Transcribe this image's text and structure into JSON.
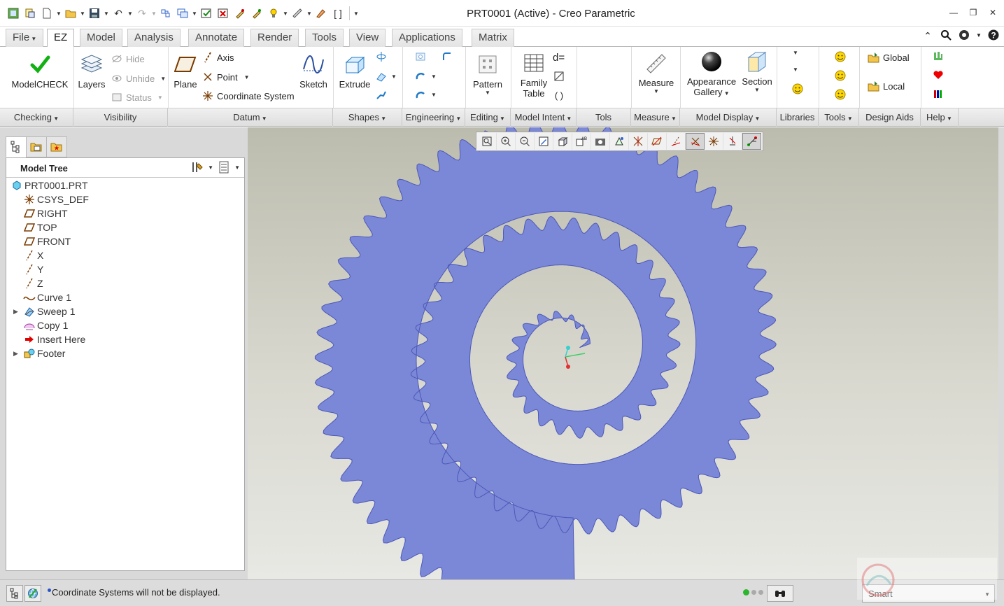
{
  "window": {
    "title": "PRT0001 (Active) - Creo Parametric"
  },
  "quick_access": [
    "new-session-icon",
    "open-file-icon",
    "new-file-icon",
    "open-folder-icon",
    "save-icon",
    "undo-icon",
    "redo-icon",
    "regenerate-icon",
    "windows-icon",
    "check-icon",
    "close-window-icon",
    "paint-icon",
    "paint2-icon",
    "bulb-icon",
    "ruler-icon",
    "rename-icon",
    "brackets-icon",
    "customize-icon"
  ],
  "tabs": [
    {
      "label": "File"
    },
    {
      "label": "EZ"
    },
    {
      "label": "Model"
    },
    {
      "label": "Analysis"
    },
    {
      "label": "Annotate"
    },
    {
      "label": "Render"
    },
    {
      "label": "Tools"
    },
    {
      "label": "View"
    },
    {
      "label": "Applications"
    },
    {
      "label": "Matrix"
    }
  ],
  "ribbon": {
    "modelcheck": "ModelCHECK",
    "layers": "Layers",
    "hide": "Hide",
    "unhide": "Unhide",
    "status": "Status",
    "plane": "Plane",
    "axis": "Axis",
    "point": "Point",
    "coordinate_system": "Coordinate System",
    "sketch": "Sketch",
    "extrude": "Extrude",
    "pattern": "Pattern",
    "family_table_1": "Family",
    "family_table_2": "Table",
    "d_equals": "d=",
    "measure": "Measure",
    "appearance_1": "Appearance",
    "appearance_2": "Gallery",
    "section": "Section",
    "global": "Global",
    "local": "Local"
  },
  "groups": [
    {
      "label": "Checking",
      "dropdown": true
    },
    {
      "label": "Visibility",
      "dropdown": false
    },
    {
      "label": "Datum",
      "dropdown": true
    },
    {
      "label": "Shapes",
      "dropdown": true
    },
    {
      "label": "Engineering",
      "dropdown": true
    },
    {
      "label": "Editing",
      "dropdown": true
    },
    {
      "label": "Model Intent",
      "dropdown": true
    },
    {
      "label": "Tols",
      "dropdown": false
    },
    {
      "label": "Measure",
      "dropdown": true
    },
    {
      "label": "Model Display",
      "dropdown": true
    },
    {
      "label": "Libraries",
      "dropdown": false
    },
    {
      "label": "Tools",
      "dropdown": true
    },
    {
      "label": "Design Aids",
      "dropdown": false
    },
    {
      "label": "Help",
      "dropdown": true
    }
  ],
  "model_tree": {
    "title": "Model Tree",
    "items": [
      {
        "label": "PRT0001.PRT",
        "icon": "part-icon",
        "expandable": false
      },
      {
        "label": "CSYS_DEF",
        "icon": "csys-icon",
        "expandable": false
      },
      {
        "label": "RIGHT",
        "icon": "datum-plane-icon",
        "expandable": false
      },
      {
        "label": "TOP",
        "icon": "datum-plane-icon",
        "expandable": false
      },
      {
        "label": "FRONT",
        "icon": "datum-plane-icon",
        "expandable": false
      },
      {
        "label": "X",
        "icon": "datum-axis-icon",
        "expandable": false
      },
      {
        "label": "Y",
        "icon": "datum-axis-icon",
        "expandable": false
      },
      {
        "label": "Z",
        "icon": "datum-axis-icon",
        "expandable": false
      },
      {
        "label": "Curve 1",
        "icon": "curve-icon",
        "expandable": false
      },
      {
        "label": "Sweep 1",
        "icon": "sweep-icon",
        "expandable": true
      },
      {
        "label": "Copy 1",
        "icon": "copy-icon",
        "expandable": false
      },
      {
        "label": "Insert Here",
        "icon": "insert-arrow-icon",
        "expandable": false
      },
      {
        "label": "Footer",
        "icon": "footer-icon",
        "expandable": true
      }
    ]
  },
  "view_toolbar": [
    "refit-icon",
    "zoom-in-icon",
    "zoom-out-icon",
    "repaint-icon",
    "display-style-icon",
    "saved-orientations-icon",
    "view-manager-icon",
    "perspective-icon",
    "datum-display-icon",
    "plane-display-icon",
    "axis-display-icon",
    "point-display-icon",
    "csys-display-icon",
    "annotation-display-icon",
    "spin-center-icon"
  ],
  "statusbar": {
    "message": "Coordinate Systems will not be displayed.",
    "filter": "Smart"
  },
  "colors": {
    "part_fill": "#7b88d8",
    "part_edge": "#4c58b6",
    "bg_top": "#bcbcae",
    "bg_bottom": "#e8e8e4"
  }
}
